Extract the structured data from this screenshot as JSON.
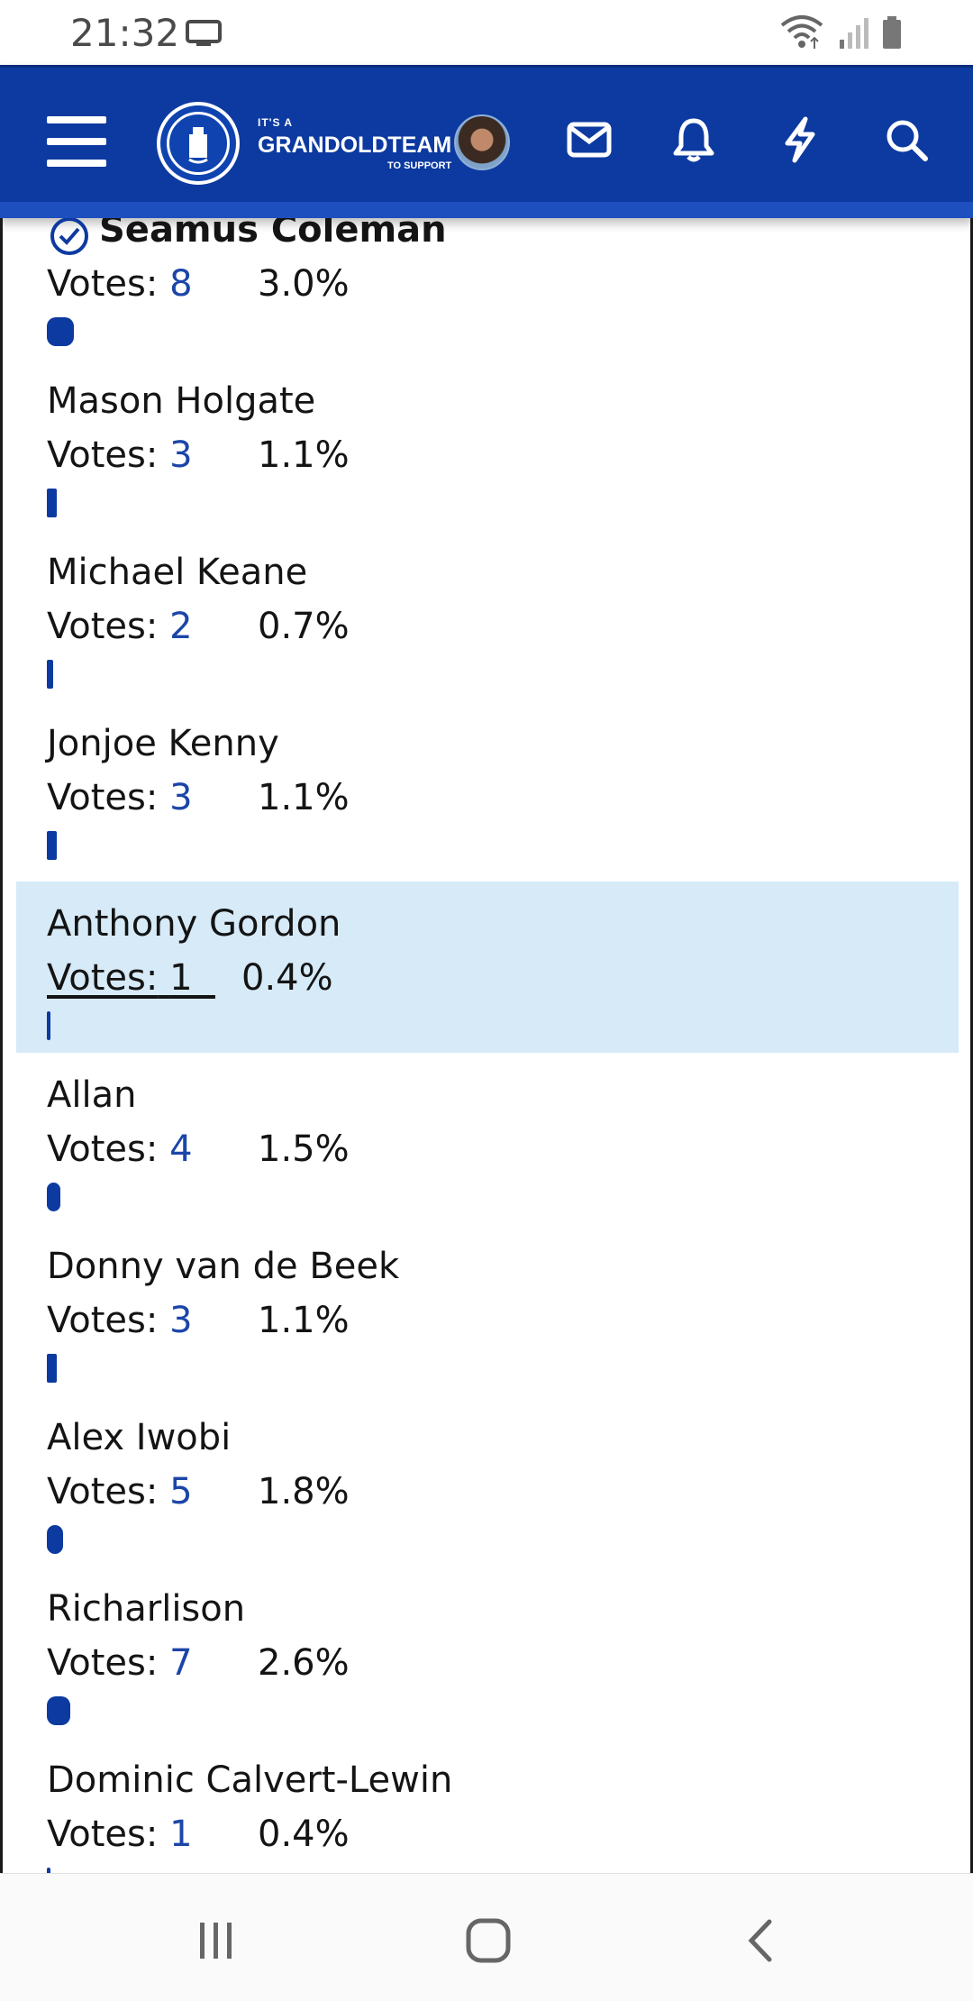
{
  "status_bar": {
    "time": "21:32",
    "icons": [
      "screen-mirror-icon",
      "wifi-icon",
      "signal-icon",
      "battery-icon"
    ]
  },
  "header": {
    "logo": {
      "small_text": "IT'S A",
      "main_text": "GRANDOLDTEAM",
      "sub_text": "TO SUPPORT"
    },
    "icons": [
      "menu-icon",
      "avatar",
      "mail-icon",
      "bell-icon",
      "lightning-icon",
      "search-icon"
    ],
    "colors": {
      "primary": "#0d3aa0",
      "accent_band": "#1e4fbf"
    }
  },
  "poll": {
    "votes_label": "Votes:",
    "options": [
      {
        "name": "Seamus Coleman",
        "votes": "8",
        "percent": "3.0%",
        "share": 0.03,
        "selected": true
      },
      {
        "name": "Mason Holgate",
        "votes": "3",
        "percent": "1.1%",
        "share": 0.011
      },
      {
        "name": "Michael Keane",
        "votes": "2",
        "percent": "0.7%",
        "share": 0.007
      },
      {
        "name": "Jonjoe Kenny",
        "votes": "3",
        "percent": "1.1%",
        "share": 0.011
      },
      {
        "name": "Anthony Gordon",
        "votes": "1",
        "percent": "0.4%",
        "share": 0.004,
        "highlighted": true
      },
      {
        "name": "Allan",
        "votes": "4",
        "percent": "1.5%",
        "share": 0.015
      },
      {
        "name": "Donny van de Beek",
        "votes": "3",
        "percent": "1.1%",
        "share": 0.011
      },
      {
        "name": "Alex Iwobi",
        "votes": "5",
        "percent": "1.8%",
        "share": 0.018
      },
      {
        "name": "Richarlison",
        "votes": "7",
        "percent": "2.6%",
        "share": 0.026
      },
      {
        "name": "Dominic Calvert-Lewin",
        "votes": "1",
        "percent": "0.4%",
        "share": 0.004
      }
    ],
    "colors": {
      "bar": "#0d3aa0",
      "count_text": "#1b45a8",
      "highlight_bg": "#d6eaf8"
    }
  },
  "nav_bar": {
    "icons": [
      "recent-apps-icon",
      "home-icon",
      "back-icon"
    ]
  }
}
